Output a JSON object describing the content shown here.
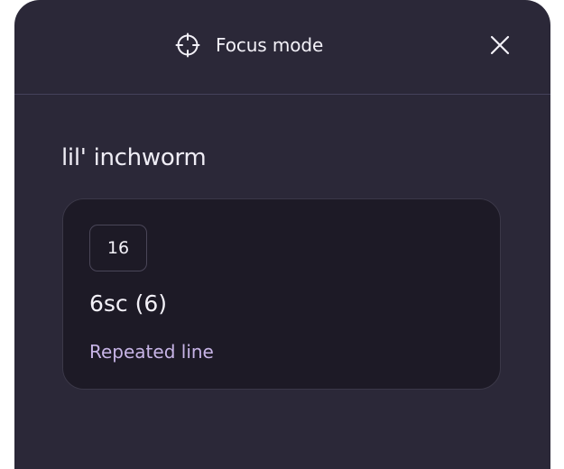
{
  "header": {
    "title": "Focus mode",
    "icon": "crosshair-icon",
    "close_icon": "close-icon"
  },
  "pattern": {
    "name": "lil' inchworm"
  },
  "card": {
    "row_number": "16",
    "instruction": "6sc (6)",
    "label": "Repeated line"
  },
  "colors": {
    "modal_bg": "#2b2838",
    "card_bg": "#1d1a26",
    "accent_label": "#c7b4e6",
    "text": "#f3f1f8"
  }
}
